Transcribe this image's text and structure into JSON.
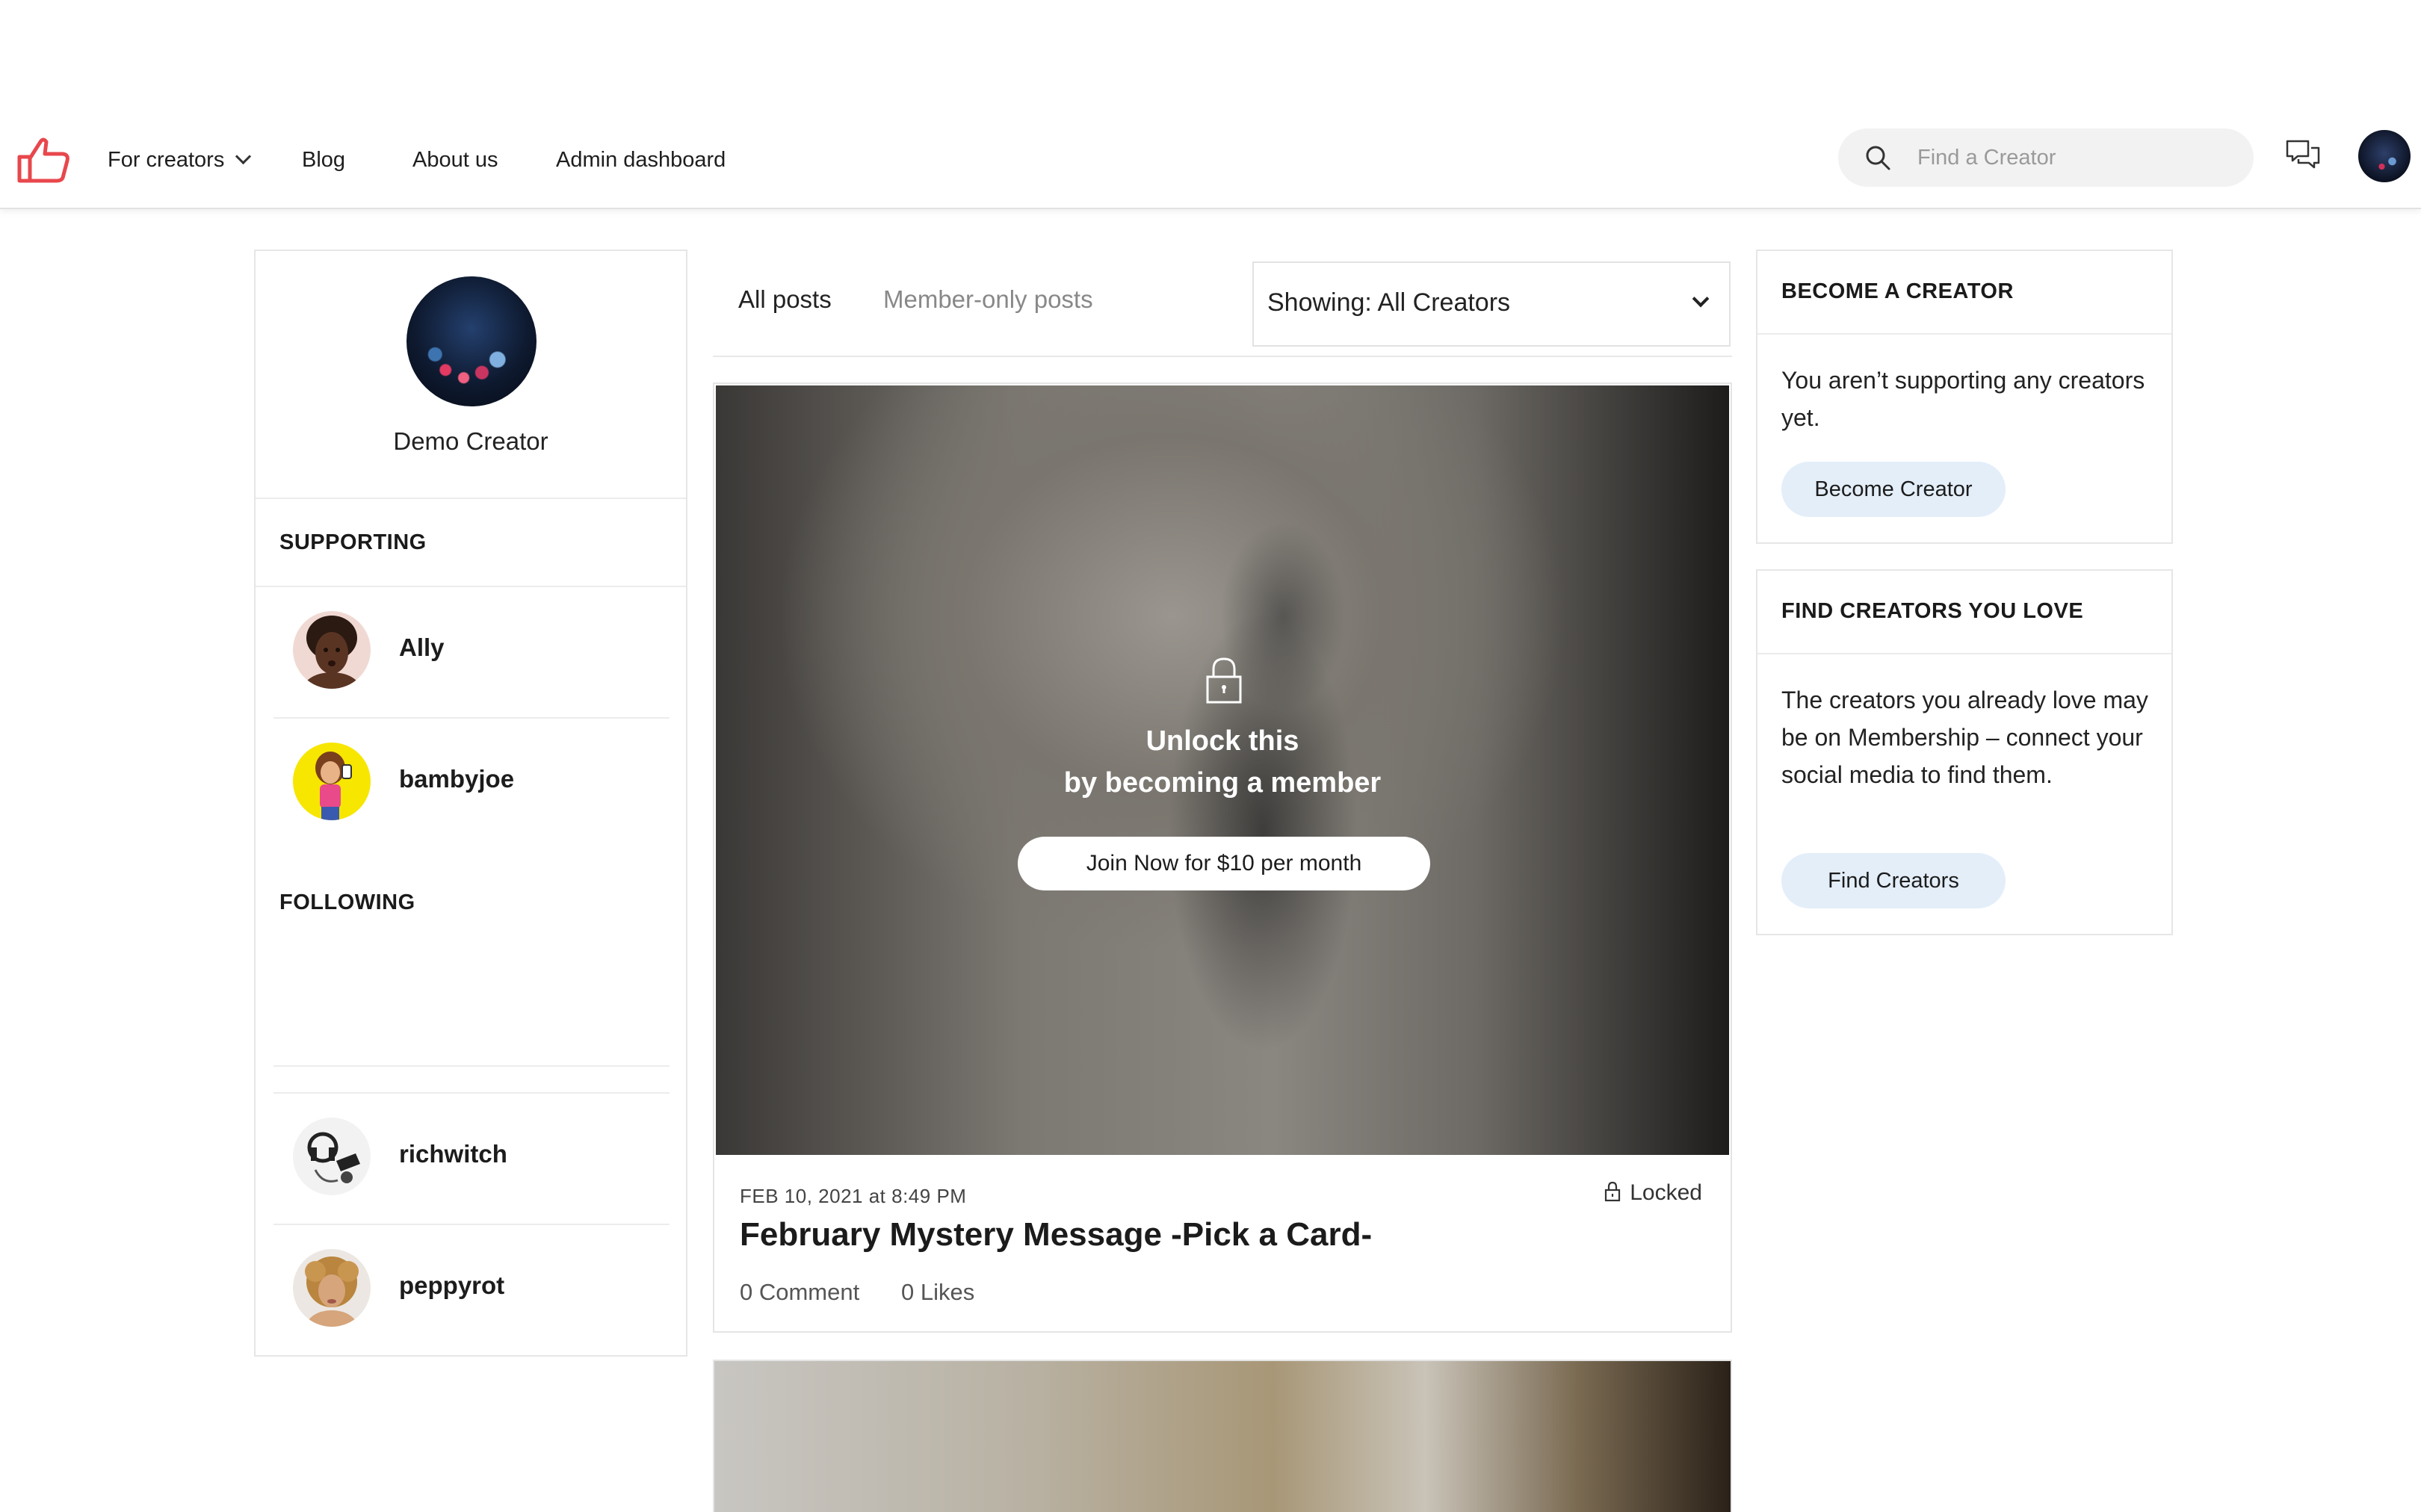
{
  "nav": {
    "links": [
      {
        "label": "For creators"
      },
      {
        "label": "Blog"
      },
      {
        "label": "About us"
      },
      {
        "label": "Admin dashboard"
      }
    ],
    "search_placeholder": "Find a Creator"
  },
  "profile": {
    "name": "Demo Creator"
  },
  "supporting": {
    "title": "SUPPORTING",
    "people": [
      "Ally",
      "bambyjoe"
    ]
  },
  "following": {
    "title": "FOLLOWING",
    "people": [
      "richwitch",
      "peppyrot"
    ]
  },
  "tabs": {
    "all": "All posts",
    "member": "Member-only posts"
  },
  "filter": {
    "label": "Showing: All Creators"
  },
  "post": {
    "unlock_line1": "Unlock this",
    "unlock_line2": "by becoming a member",
    "join_label": "Join Now for $10 per month",
    "date": "FEB 10, 2021 at 8:49 PM",
    "status": "Locked",
    "title": "February Mystery Message -Pick a Card-",
    "comments": "0 Comment",
    "likes": "0 Likes"
  },
  "become_creator": {
    "title": "BECOME A CREATOR",
    "text": "You aren’t supporting any creators yet.",
    "button": "Become Creator"
  },
  "find_creators": {
    "title": "FIND CREATORS YOU LOVE",
    "text": "The creators you already love may be on Membership – connect your social media to find them.",
    "button": "Find Creators"
  },
  "colors": {
    "brand": "#e8474c",
    "button_bg": "#e3eef9"
  }
}
